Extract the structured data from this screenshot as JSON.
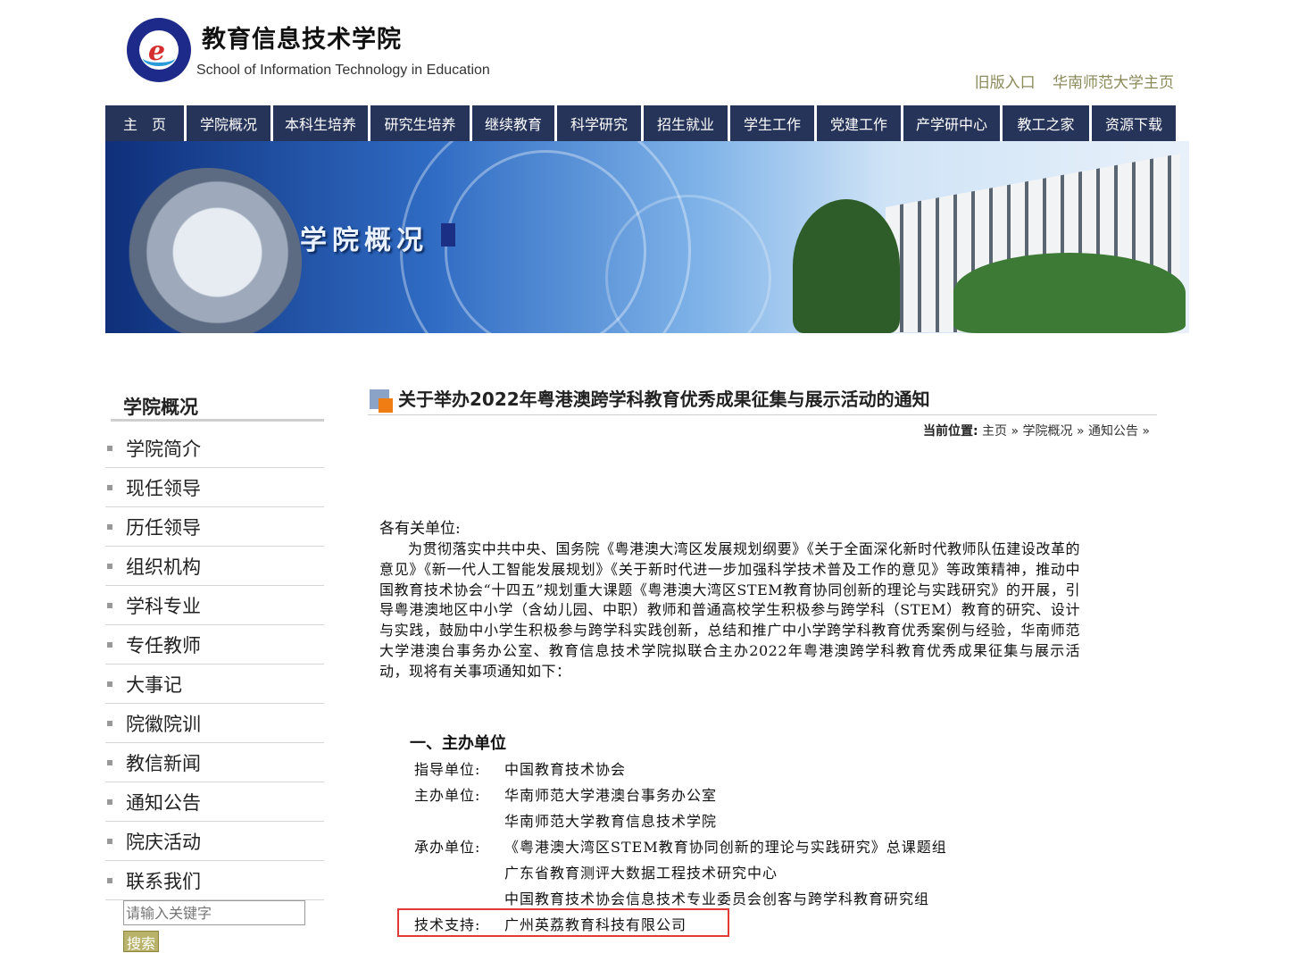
{
  "header": {
    "title_cn": "教育信息技术学院",
    "title_en": "School of Information Technology in Education",
    "links": [
      "旧版入口",
      "华南师范大学主页"
    ]
  },
  "nav": {
    "items": [
      "主　页",
      "学院概况",
      "本科生培养",
      "研究生培养",
      "继续教育",
      "科学研究",
      "招生就业",
      "学生工作",
      "党建工作",
      "产学研中心",
      "教工之家",
      "资源下载"
    ]
  },
  "banner": {
    "label": "学院概况"
  },
  "sidebar": {
    "title": "学院概况",
    "items": [
      "学院简介",
      "现任领导",
      "历任领导",
      "组织机构",
      "学科专业",
      "专任教师",
      "大事记",
      "院徽院训",
      "教信新闻",
      "通知公告",
      "院庆活动",
      "联系我们"
    ],
    "search_placeholder": "请输入关键字",
    "search_button": "搜索"
  },
  "article": {
    "title": "关于举办2022年粤港澳跨学科教育优秀成果征集与展示活动的通知",
    "breadcrumb_label": "当前位置:",
    "breadcrumb": [
      "主页",
      "学院概况",
      "通知公告"
    ],
    "salutation": "各有关单位:",
    "paragraph": "为贯彻落实中共中央、国务院《粤港澳大湾区发展规划纲要》《关于全面深化新时代教师队伍建设改革的意见》《新一代人工智能发展规划》《关于新时代进一步加强科学技术普及工作的意见》等政策精神，推动中国教育技术协会“十四五”规划重大课题《粤港澳大湾区STEM教育协同创新的理论与实践研究》的开展，引导粤港澳地区中小学（含幼儿园、中职）教师和普通高校学生积极参与跨学科（STEM）教育的研究、设计与实践，鼓励中小学生积极参与跨学科实践创新，总结和推广中小学跨学科教育优秀案例与经验，华南师范大学港澳台事务办公室、教育信息技术学院拟联合主办2022年粤港澳跨学科教育优秀成果征集与展示活动，现将有关事项通知如下：",
    "section1_heading": "一、主办单位",
    "organizers": [
      {
        "label": "指导单位:",
        "values": [
          "中国教育技术协会"
        ]
      },
      {
        "label": "主办单位:",
        "values": [
          "华南师范大学港澳台事务办公室",
          "华南师范大学教育信息技术学院"
        ]
      },
      {
        "label": "承办单位:",
        "values": [
          "《粤港澳大湾区STEM教育协同创新的理论与实践研究》总课题组",
          "广东省教育测评大数据工程技术研究中心",
          "中国教育技术协会信息技术专业委员会创客与跨学科教育研究组"
        ]
      },
      {
        "label": "技术支持:",
        "values": [
          "广州英荔教育科技有限公司"
        ]
      }
    ]
  },
  "colors": {
    "nav_bg": "#27345a",
    "top_link": "#8a8a5a",
    "highlight_box": "#e03a3a",
    "search_button": "#b8b26a"
  }
}
